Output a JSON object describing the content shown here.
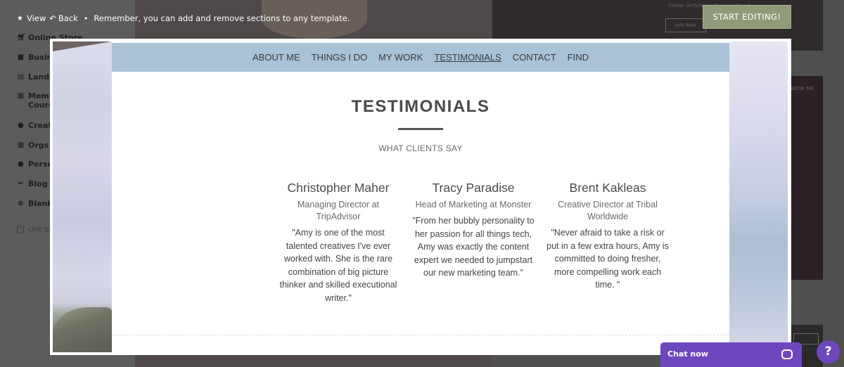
{
  "topbar": {
    "view_label": "View",
    "back_label": "Back",
    "separator": "•",
    "message": "Remember, you can add and remove sections to any template.",
    "start_button": "START EDITING!"
  },
  "sidebar": {
    "items": [
      {
        "label": "Online Store",
        "icon": "cart-icon"
      },
      {
        "label": "Busin",
        "icon": "briefcase-icon"
      },
      {
        "label": "Landi",
        "icon": "document-icon"
      },
      {
        "label": "Memb",
        "label2": "Cours",
        "icon": "book-icon"
      },
      {
        "label": "Creat",
        "icon": "palette-icon"
      },
      {
        "label": "Orgs",
        "icon": "building-icon"
      },
      {
        "label": "Perso",
        "icon": "person-icon"
      },
      {
        "label": "Blog",
        "icon": "feather-icon"
      },
      {
        "label": "Blank",
        "icon": "plus-icon"
      }
    ],
    "checkbox_label": "One p"
  },
  "background_cards": {
    "top_caption": "Career Architect | Personal Brand",
    "top_button": "Join Now",
    "mid_caption": "BOOK ME"
  },
  "site": {
    "nav": [
      "ABOUT ME",
      "THINGS I DO",
      "MY WORK",
      "TESTIMONIALS",
      "CONTACT",
      "FIND"
    ],
    "active_nav": "TESTIMONIALS",
    "title": "TESTIMONIALS",
    "subtitle": "WHAT CLIENTS SAY",
    "testimonials": [
      {
        "name": "Christopher Maher",
        "role": "Managing Director at TripAdvisor",
        "quote": "\"Amy is one of the most talented creatives I've ever worked with. She is the rare combination of big picture thinker and skilled executional writer.\""
      },
      {
        "name": "Tracy Paradise",
        "role": "Head of Marketing at Monster",
        "quote": "\"From her bubbly personality to her passion for all things tech, Amy was exactly the content expert we needed to jumpstart our new marketing team.\""
      },
      {
        "name": "Brent Kakleas",
        "role": "Creative Director at Tribal Worldwide",
        "quote": "\"Never afraid to take a risk or put in a few extra hours, Amy is committed to doing fresher, more compelling work each time. \""
      }
    ]
  },
  "chat": {
    "label": "Chat now",
    "help": "?"
  },
  "colors": {
    "nav_bg": "#a9c2d6",
    "start_button_bg": "#8f9b78",
    "chat_bg": "#6e47bf"
  }
}
